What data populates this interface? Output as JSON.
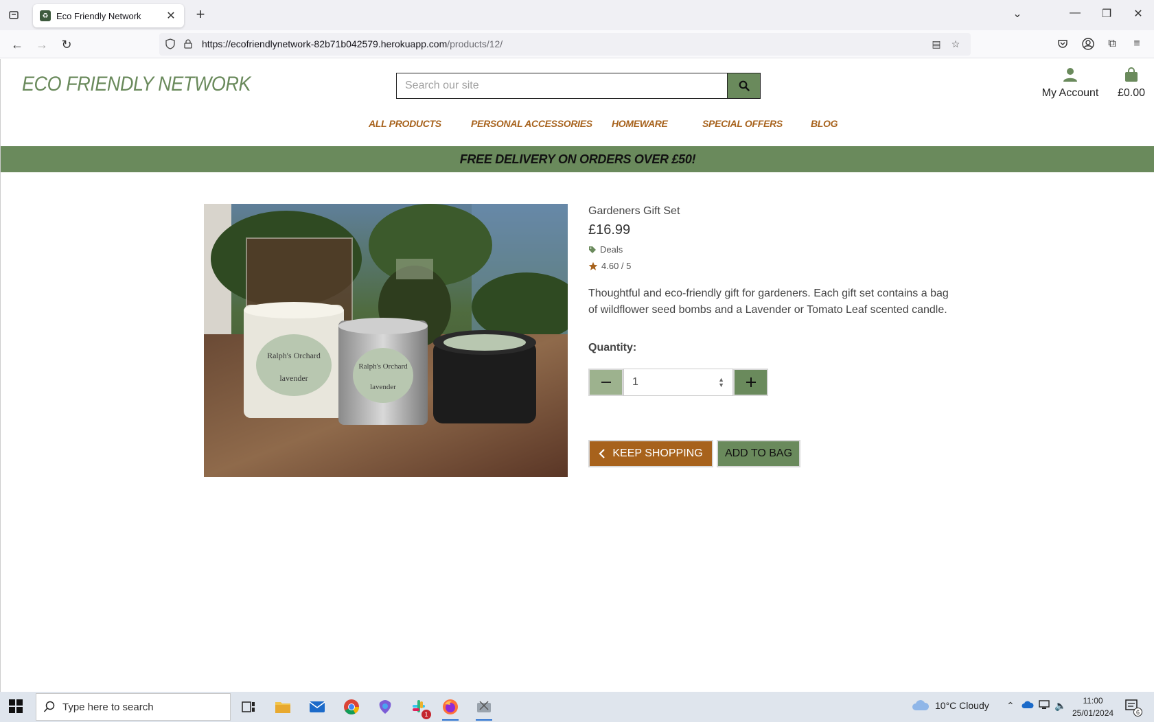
{
  "browser": {
    "tab_title": "Eco Friendly Network",
    "url_host": "https://ecofriendlynetwork-82b71b042579.herokuapp.com",
    "url_path": "/products/12/"
  },
  "site": {
    "logo": "ECO FRIENDLY NETWORK",
    "search_placeholder": "Search our site",
    "account_label": "My Account",
    "bag_total": "£0.00",
    "nav": [
      "ALL PRODUCTS",
      "PERSONAL ACCESSORIES",
      "HOMEWARE",
      "SPECIAL OFFERS",
      "BLOG"
    ],
    "banner": "FREE DELIVERY ON ORDERS OVER £50!",
    "colors": {
      "brand_green": "#6a8a5c",
      "accent_orange": "#a7621c"
    }
  },
  "product": {
    "name": "Gardeners Gift Set",
    "price": "£16.99",
    "category": "Deals",
    "rating": "4.60 / 5",
    "description": "Thoughtful and eco-friendly gift for gardeners. Each gift set contains a bag of wildflower seed bombs and a Lavender or Tomato Leaf scented candle.",
    "quantity_label": "Quantity:",
    "quantity_value": "1",
    "keep_shopping": "KEEP SHOPPING",
    "add_to_bag": "ADD TO BAG",
    "image_labels": [
      "Ralph's Orchard",
      "lavender",
      "Ralph's Orchard",
      "lavender"
    ]
  },
  "taskbar": {
    "search_placeholder": "Type here to search",
    "weather": "10°C  Cloudy",
    "time": "11:00",
    "date": "25/01/2024",
    "notification_count": "6",
    "slack_badge": "1"
  }
}
